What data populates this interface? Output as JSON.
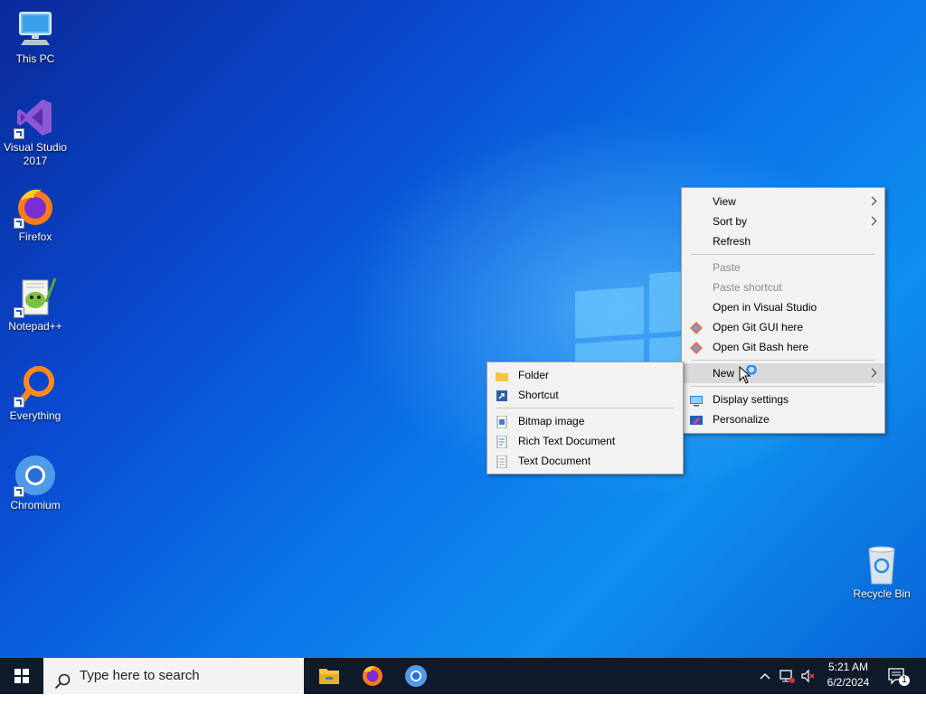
{
  "desktop": {
    "icons": [
      {
        "label": "This PC"
      },
      {
        "label": "Visual Studio 2017"
      },
      {
        "label": "Firefox"
      },
      {
        "label": "Notepad++"
      },
      {
        "label": "Everything"
      },
      {
        "label": "Chromium"
      },
      {
        "label": "Recycle Bin"
      }
    ]
  },
  "context_menu": {
    "items": [
      {
        "label": "View"
      },
      {
        "label": "Sort by"
      },
      {
        "label": "Refresh"
      },
      {
        "label": "Paste"
      },
      {
        "label": "Paste shortcut"
      },
      {
        "label": "Open in Visual Studio"
      },
      {
        "label": "Open Git GUI here"
      },
      {
        "label": "Open Git Bash here"
      },
      {
        "label": "New"
      },
      {
        "label": "Display settings"
      },
      {
        "label": "Personalize"
      }
    ]
  },
  "new_submenu": {
    "items": [
      {
        "label": "Folder"
      },
      {
        "label": "Shortcut"
      },
      {
        "label": "Bitmap image"
      },
      {
        "label": "Rich Text Document"
      },
      {
        "label": "Text Document"
      }
    ]
  },
  "taskbar": {
    "search_placeholder": "Type here to search",
    "time": "5:21 AM",
    "date": "6/2/2024",
    "notification_count": "1"
  },
  "colors": {
    "taskbar_bg": "#0f1a2b",
    "menu_bg": "#f2f2f2",
    "accent": "#0a74e8"
  }
}
